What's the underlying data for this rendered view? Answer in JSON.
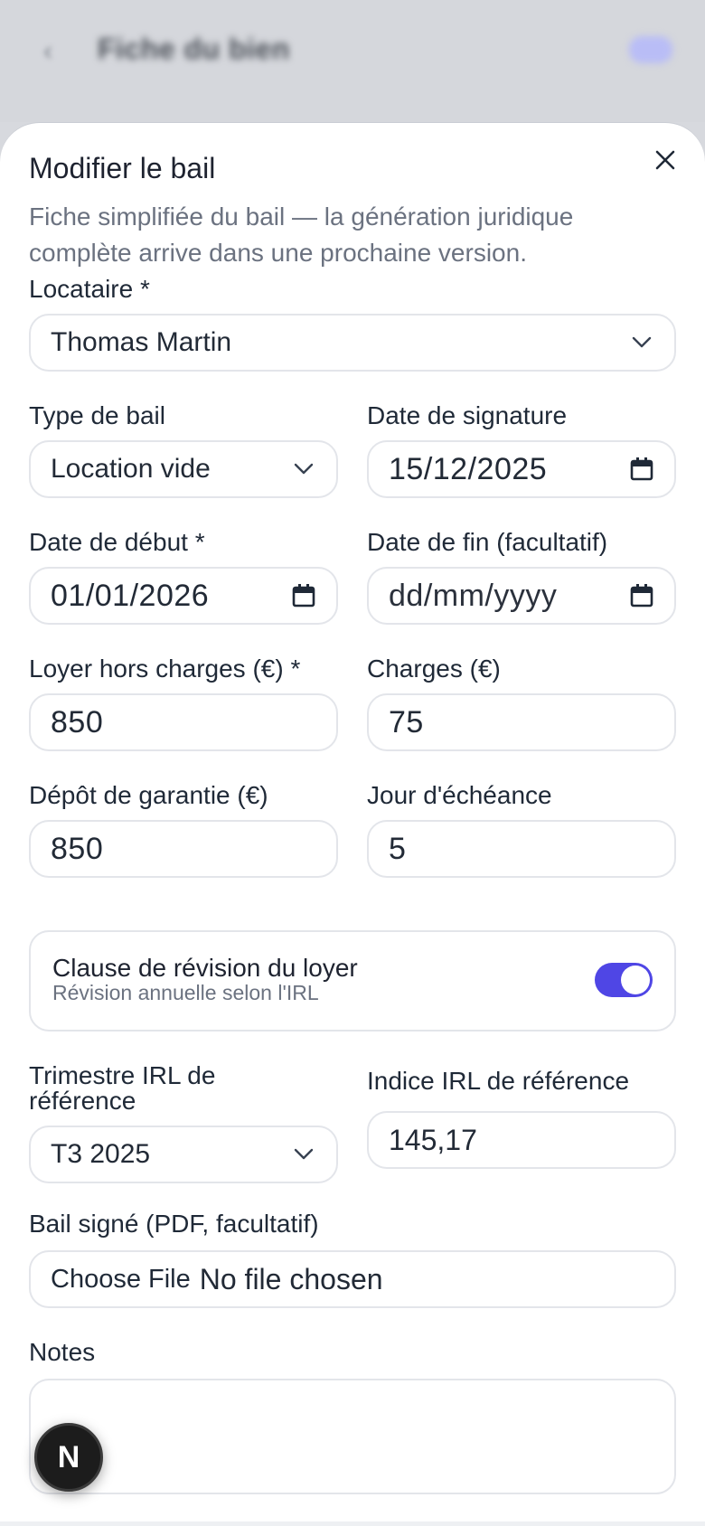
{
  "background": {
    "title": "Fiche du bien"
  },
  "sheet": {
    "title": "Modifier le bail",
    "description": "Fiche simplifiée du bail — la génération juridique complète arrive dans une prochaine version."
  },
  "form": {
    "tenant": {
      "label": "Locataire *",
      "value": "Thomas Martin"
    },
    "lease_type": {
      "label": "Type de bail",
      "value": "Location vide"
    },
    "signature_date": {
      "label": "Date de signature",
      "value": "15/12/2025"
    },
    "start_date": {
      "label": "Date de début *",
      "value": "01/01/2026"
    },
    "end_date": {
      "label": "Date de fin (facultatif)",
      "placeholder": "dd/mm/yyyy"
    },
    "rent": {
      "label": "Loyer hors charges (€) *",
      "value": "850"
    },
    "charges": {
      "label": "Charges (€)",
      "value": "75"
    },
    "deposit": {
      "label": "Dépôt de garantie (€)",
      "value": "850"
    },
    "due_day": {
      "label": "Jour d'échéance",
      "value": "5"
    },
    "revision": {
      "title": "Clause de révision du loyer",
      "subtitle": "Révision annuelle selon l'IRL",
      "enabled": true
    },
    "irl_quarter": {
      "label": "Trimestre IRL de référence",
      "value": "T3 2025"
    },
    "irl_index": {
      "label": "Indice IRL de référence",
      "value": "145,17"
    },
    "signed_lease": {
      "label": "Bail signé (PDF, facultatif)",
      "button": "Choose File",
      "status": "No file chosen"
    },
    "notes": {
      "label": "Notes",
      "value": ""
    }
  },
  "badge": {
    "letter": "N"
  },
  "colors": {
    "accent": "#4f46e5",
    "border": "#e3e5ea",
    "muted": "#6b7280"
  }
}
